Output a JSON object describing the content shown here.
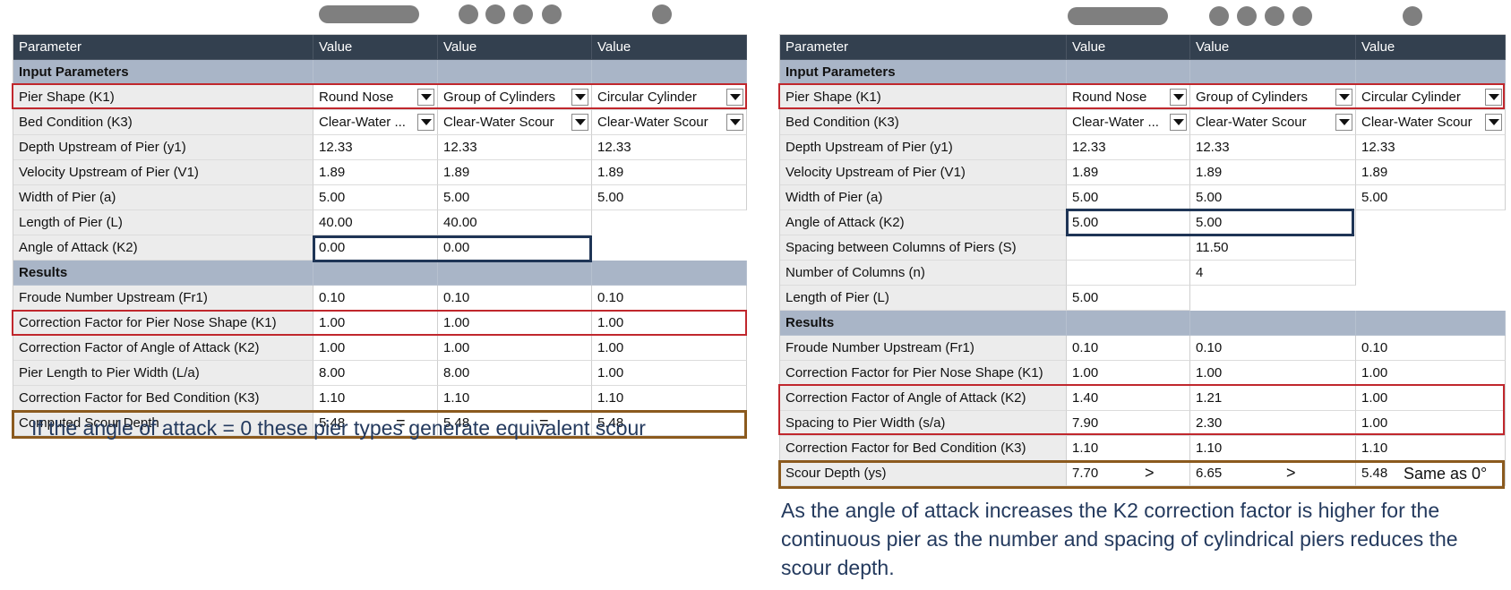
{
  "left": {
    "headers": [
      "Parameter",
      "Value",
      "Value",
      "Value"
    ],
    "rows": [
      {
        "kind": "sec",
        "label": "Input Parameters"
      },
      {
        "label": "Pier Shape (K1)",
        "values": [
          "Round Nose",
          "Group of Cylinders",
          "Circular Cylinder"
        ],
        "dropdown": true
      },
      {
        "label": "Bed Condition (K3)",
        "values": [
          "Clear-Water ...",
          "Clear-Water Scour",
          "Clear-Water Scour"
        ],
        "dropdown": true
      },
      {
        "label": "Depth Upstream of Pier (y1)",
        "values": [
          "12.33",
          "12.33",
          "12.33"
        ]
      },
      {
        "label": "Velocity Upstream of Pier (V1)",
        "values": [
          "1.89",
          "1.89",
          "1.89"
        ]
      },
      {
        "label": "Width of Pier (a)",
        "values": [
          "5.00",
          "5.00",
          "5.00"
        ]
      },
      {
        "label": "Length of Pier (L)",
        "values": [
          "40.00",
          "40.00",
          null
        ]
      },
      {
        "label": "Angle of Attack (K2)",
        "values": [
          "0.00",
          "0.00",
          null
        ]
      },
      {
        "kind": "sec",
        "label": "Results"
      },
      {
        "label": "Froude Number Upstream (Fr1)",
        "values": [
          "0.10",
          "0.10",
          "0.10"
        ]
      },
      {
        "label": "Correction Factor for Pier Nose Shape (K1)",
        "values": [
          "1.00",
          "1.00",
          "1.00"
        ]
      },
      {
        "label": "Correction Factor of Angle of Attack (K2)",
        "values": [
          "1.00",
          "1.00",
          "1.00"
        ]
      },
      {
        "label": "Pier Length to Pier Width (L/a)",
        "values": [
          "8.00",
          "8.00",
          "1.00"
        ]
      },
      {
        "label": "Correction Factor for Bed Condition (K3)",
        "values": [
          "1.10",
          "1.10",
          "1.10"
        ]
      },
      {
        "label": "Computed Scour Depth",
        "values": [
          "5.48",
          "5.48",
          "5.48"
        ]
      }
    ],
    "comparators": [
      "=",
      "="
    ],
    "caption": "If the angle of attack = 0 these pier types generate equivalent scour"
  },
  "right": {
    "headers": [
      "Parameter",
      "Value",
      "Value",
      "Value"
    ],
    "rows": [
      {
        "kind": "sec",
        "label": "Input Parameters"
      },
      {
        "label": "Pier Shape (K1)",
        "values": [
          "Round Nose",
          "Group of Cylinders",
          "Circular Cylinder"
        ],
        "dropdown": true
      },
      {
        "label": "Bed Condition (K3)",
        "values": [
          "Clear-Water ...",
          "Clear-Water Scour",
          "Clear-Water Scour"
        ],
        "dropdown": true
      },
      {
        "label": "Depth Upstream of Pier (y1)",
        "values": [
          "12.33",
          "12.33",
          "12.33"
        ]
      },
      {
        "label": "Velocity Upstream of Pier (V1)",
        "values": [
          "1.89",
          "1.89",
          "1.89"
        ]
      },
      {
        "label": "Width of Pier (a)",
        "values": [
          "5.00",
          "5.00",
          "5.00"
        ]
      },
      {
        "label": "Angle of Attack (K2)",
        "values": [
          "5.00",
          "5.00",
          null
        ]
      },
      {
        "label": "Spacing between Columns of Piers (S)",
        "values": [
          "",
          "11.50",
          null
        ]
      },
      {
        "label": "Number of Columns (n)",
        "values": [
          "",
          "4",
          null
        ]
      },
      {
        "label": "Length of Pier (L)",
        "values": [
          "5.00",
          null,
          null
        ]
      },
      {
        "kind": "sec",
        "label": "Results"
      },
      {
        "label": "Froude Number Upstream (Fr1)",
        "values": [
          "0.10",
          "0.10",
          "0.10"
        ]
      },
      {
        "label": "Correction Factor for Pier Nose Shape (K1)",
        "values": [
          "1.00",
          "1.00",
          "1.00"
        ]
      },
      {
        "label": "Correction Factor of Angle of Attack (K2)",
        "values": [
          "1.40",
          "1.21",
          "1.00"
        ]
      },
      {
        "label": "Spacing to Pier Width (s/a)",
        "values": [
          "7.90",
          "2.30",
          "1.00"
        ]
      },
      {
        "label": "Correction Factor for Bed Condition (K3)",
        "values": [
          "1.10",
          "1.10",
          "1.10"
        ]
      },
      {
        "label": "Scour Depth (ys)",
        "values": [
          "7.70",
          "6.65",
          "5.48"
        ]
      }
    ],
    "comparators": [
      ">",
      ">"
    ],
    "note": "Same as 0°",
    "caption": "As the angle of attack increases the K2 correction factor is higher for the continuous pier as the number and spacing of cylindrical piers reduces the scour depth."
  },
  "colors": {
    "header_bg": "#33404f",
    "section_bg": "#a9b5c7",
    "highlight_red": "#c0272d",
    "highlight_navy": "#1f3556",
    "highlight_brown": "#8b5a1e",
    "caption_text": "#243a5e"
  }
}
